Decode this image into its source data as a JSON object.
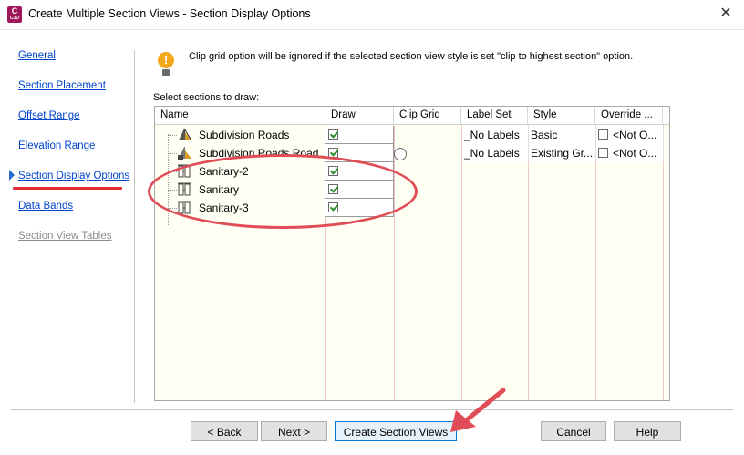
{
  "window": {
    "title": "Create Multiple Section Views - Section Display Options",
    "app_icon_letter": "C",
    "app_icon_sub": "C3D",
    "close_glyph": "✕"
  },
  "nav": {
    "items": [
      {
        "label": "General"
      },
      {
        "label": "Section Placement"
      },
      {
        "label": "Offset Range"
      },
      {
        "label": "Elevation Range"
      },
      {
        "label": "Section Display Options"
      },
      {
        "label": "Data Bands"
      },
      {
        "label": "Section View Tables"
      }
    ],
    "active": "Section Display Options"
  },
  "notice": {
    "icon": "lightbulb-icon",
    "glyph": "!",
    "text": "Clip grid option will be ignored if the selected section view style is set \"clip to highest section\" option."
  },
  "grid": {
    "caption": "Select sections to draw:",
    "columns": [
      "Name",
      "Draw",
      "Clip Grid",
      "Label Set",
      "Style",
      "Override ..."
    ],
    "rows": [
      {
        "name": "Subdivision Roads",
        "icon": "road-section-icon",
        "draw": true,
        "clip": null,
        "label_set": "_No Labels",
        "style": "Basic",
        "override": "<Not O..."
      },
      {
        "name": "Subdivision Roads Road...",
        "icon": "road-surface-section-icon",
        "draw": true,
        "clip": false,
        "label_set": "_No Labels",
        "style": "Existing Gr...",
        "override": "<Not O..."
      },
      {
        "name": "Sanitary-2",
        "icon": "pipe-network-icon",
        "draw": true
      },
      {
        "name": "Sanitary",
        "icon": "pipe-network-icon",
        "draw": true
      },
      {
        "name": "Sanitary-3",
        "icon": "pipe-network-icon",
        "draw": true
      }
    ]
  },
  "buttons": {
    "back": "< Back",
    "next": "Next >",
    "create": "Create Section Views",
    "cancel": "Cancel",
    "help": "Help"
  },
  "colors": {
    "annotation_red": "#e14d57",
    "link_blue": "#0044cc",
    "grid_background": "#fffff4"
  }
}
